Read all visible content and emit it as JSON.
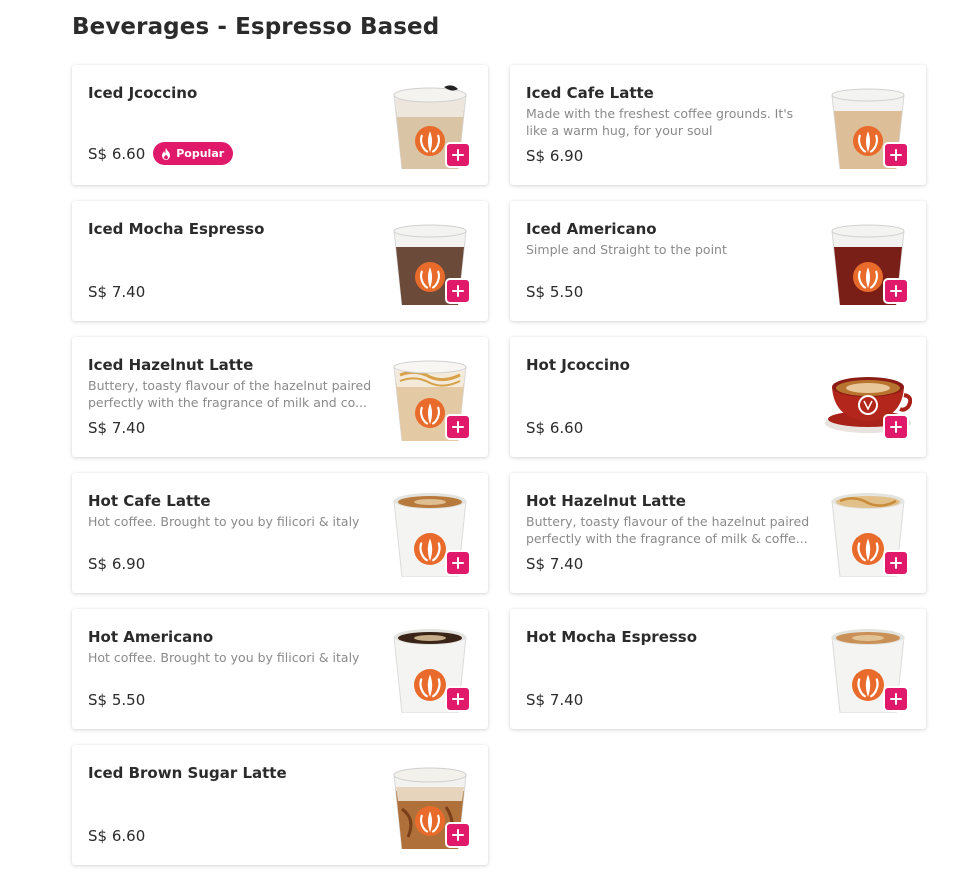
{
  "section": {
    "title": "Beverages - Espresso Based"
  },
  "colors": {
    "accent": "#e0196b",
    "brand_orange": "#e96b2c"
  },
  "items": [
    {
      "name": "Iced Jcoccino",
      "description": "",
      "price": "S$ 6.60",
      "badge": "Popular",
      "badge_icon": "flame-icon",
      "drink": "iced-foam",
      "liquid": "#d9c4a6"
    },
    {
      "name": "Iced Cafe Latte",
      "description": "Made with the freshest coffee grounds. It's like a warm hug, for your soul",
      "price": "S$ 6.90",
      "drink": "iced",
      "liquid": "#dcbf98"
    },
    {
      "name": "Iced Mocha Espresso",
      "description": "",
      "price": "S$ 7.40",
      "drink": "iced",
      "liquid": "#6b4a3a"
    },
    {
      "name": "Iced Americano",
      "description": "Simple and Straight to the point",
      "price": "S$ 5.50",
      "drink": "iced",
      "liquid": "#7a1f18"
    },
    {
      "name": "Iced Hazelnut Latte",
      "description": "Buttery, toasty flavour of the hazelnut paired\n perfectly with the fragrance of milk and co...",
      "price": "S$ 7.40",
      "drink": "iced-caramel",
      "liquid": "#e3c9a4"
    },
    {
      "name": "Hot Jcoccino",
      "description": "",
      "price": "S$ 6.60",
      "drink": "cup",
      "liquid": "#b8732e"
    },
    {
      "name": "Hot Cafe Latte",
      "description": "Hot coffee. Brought to you by filicori & italy",
      "price": "S$ 6.90",
      "drink": "hot",
      "liquid": "#b87a3c"
    },
    {
      "name": "Hot Hazelnut Latte",
      "description": "Buttery, toasty flavour of the hazelnut paired\n perfectly with the fragrance of milk & coffe...",
      "price": "S$ 7.40",
      "drink": "hot-caramel",
      "liquid": "#e2c08a"
    },
    {
      "name": "Hot Americano",
      "description": "Hot coffee. Brought to you by filicori & italy",
      "price": "S$ 5.50",
      "drink": "hot",
      "liquid": "#3a2418"
    },
    {
      "name": "Hot Mocha Espresso",
      "description": "",
      "price": "S$ 7.40",
      "drink": "hot",
      "liquid": "#c99057"
    },
    {
      "name": "Iced Brown Sugar Latte",
      "description": "",
      "price": "S$ 6.60",
      "drink": "iced-brown",
      "liquid": "#b0703a"
    }
  ]
}
